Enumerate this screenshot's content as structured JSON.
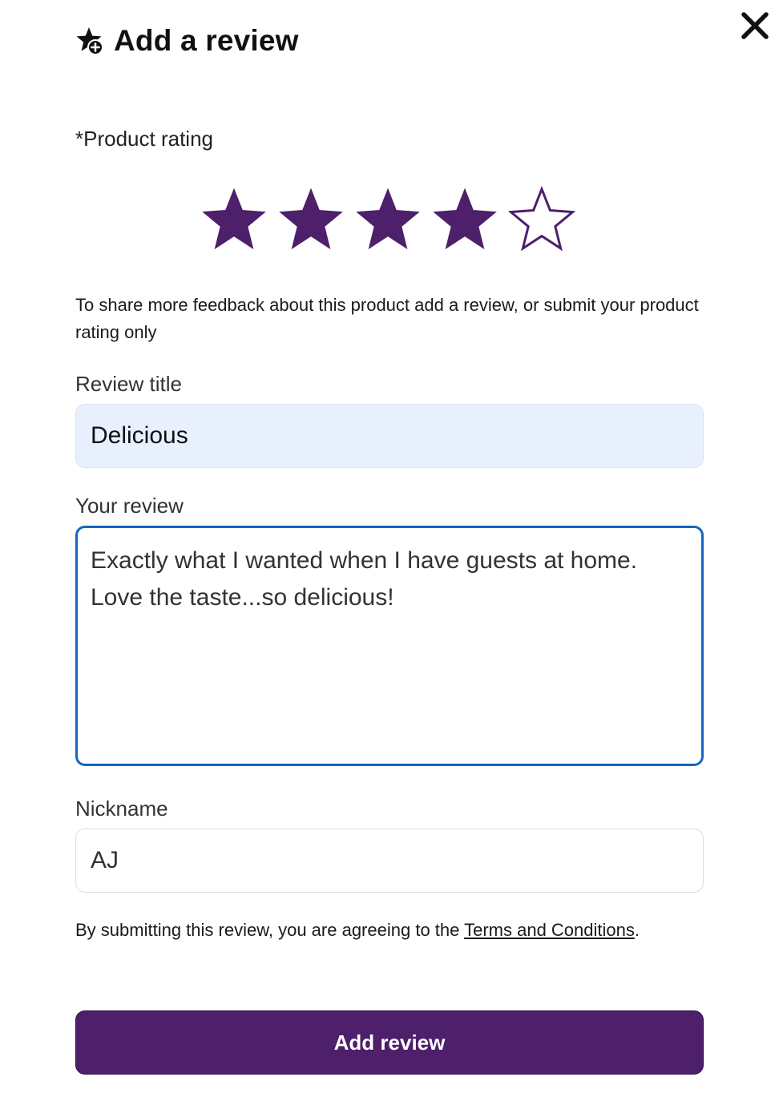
{
  "dialog": {
    "title": "Add a review",
    "header_icon": "star-plus-icon",
    "close_icon": "close-icon"
  },
  "rating": {
    "label": "*Product rating",
    "value": 4,
    "max": 5,
    "filled_color": "#4e1f6b"
  },
  "helper_text": "To share more feedback about this product add a review, or submit your product rating only",
  "fields": {
    "title": {
      "label": "Review title",
      "value": "Delicious"
    },
    "review": {
      "label": "Your review",
      "value": "Exactly what I wanted when I have guests at home. Love the taste...so delicious!"
    },
    "nickname": {
      "label": "Nickname",
      "value": "AJ"
    }
  },
  "terms": {
    "prefix": "By submitting this review, you are agreeing to the ",
    "link": "Terms and Conditions",
    "suffix": "."
  },
  "submit": {
    "label": "Add review",
    "color": "#4e1f6b"
  },
  "colors": {
    "focus_border": "#1565c0",
    "autofill_bg": "#e8f0fe"
  }
}
